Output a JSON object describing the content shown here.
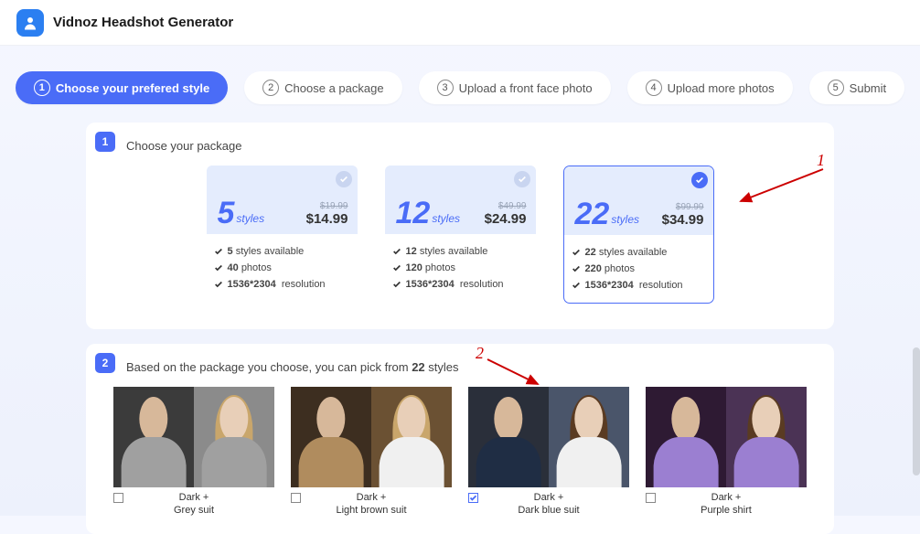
{
  "app": {
    "title": "Vidnoz Headshot Generator"
  },
  "steps": [
    {
      "num": "1",
      "label": "Choose your prefered style",
      "active": true
    },
    {
      "num": "2",
      "label": "Choose a package",
      "active": false
    },
    {
      "num": "3",
      "label": "Upload a front face photo",
      "active": false
    },
    {
      "num": "4",
      "label": "Upload more photos",
      "active": false
    },
    {
      "num": "5",
      "label": "Submit",
      "active": false
    }
  ],
  "section1": {
    "badge": "1",
    "title": "Choose your package"
  },
  "packages": [
    {
      "count": "5",
      "styles_word": "styles",
      "old_price": "$19.99",
      "new_price": "$14.99",
      "feat_styles_n": "5",
      "feat_styles_t": "styles available",
      "feat_photos_n": "40",
      "feat_photos_t": "photos",
      "feat_res_n": "1536*2304",
      "feat_res_t": "resolution",
      "selected": false
    },
    {
      "count": "12",
      "styles_word": "styles",
      "old_price": "$49.99",
      "new_price": "$24.99",
      "feat_styles_n": "12",
      "feat_styles_t": "styles available",
      "feat_photos_n": "120",
      "feat_photos_t": "photos",
      "feat_res_n": "1536*2304",
      "feat_res_t": "resolution",
      "selected": false
    },
    {
      "count": "22",
      "styles_word": "styles",
      "old_price": "$99.99",
      "new_price": "$34.99",
      "feat_styles_n": "22",
      "feat_styles_t": "styles available",
      "feat_photos_n": "220",
      "feat_photos_t": "photos",
      "feat_res_n": "1536*2304",
      "feat_res_t": "resolution",
      "selected": true
    }
  ],
  "section2": {
    "badge": "2",
    "subtitle_pre": "Based on the package you choose, you can pick from ",
    "subtitle_bold": "22",
    "subtitle_post": " styles"
  },
  "styles": [
    {
      "line1": "Dark +",
      "line2": "Grey suit",
      "checked": false
    },
    {
      "line1": "Dark +",
      "line2": "Light brown suit",
      "checked": false
    },
    {
      "line1": "Dark +",
      "line2": "Dark blue suit",
      "checked": true
    },
    {
      "line1": "Dark +",
      "line2": "Purple shirt",
      "checked": false
    }
  ],
  "annotations": {
    "n1": "1",
    "n2": "2"
  }
}
